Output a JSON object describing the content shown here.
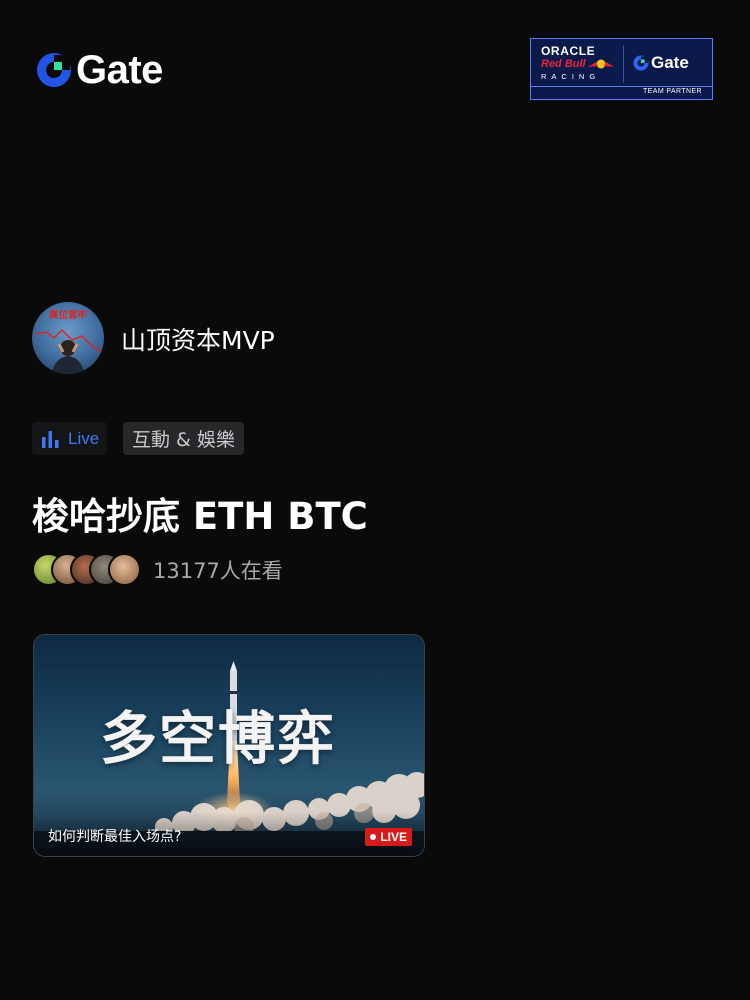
{
  "brand": {
    "name": "Gate",
    "accent": "#2354e6",
    "accent_green": "#2fe0a0"
  },
  "partner": {
    "oracle": "ORACLE",
    "redbull": "Red Bull",
    "racing": "RACING",
    "gate": "Gate",
    "team_partner": "TEAM PARTNER"
  },
  "host": {
    "name": "山顶资本MVP",
    "avatar_caption": "高位套牢"
  },
  "tags": {
    "live_label": "Live",
    "live_color": "#3f78f2",
    "category": "互動 & 娛樂"
  },
  "stream": {
    "title": "梭哈抄底 ETH BTC",
    "viewer_count": "13177人在看",
    "viewer_avatars": [
      "viewer-1",
      "viewer-2",
      "viewer-3",
      "viewer-4",
      "viewer-5"
    ]
  },
  "card": {
    "headline": "多空博弈",
    "caption": "如何判断最佳入场点?",
    "badge": "LIVE",
    "badge_color": "#d71a1a"
  }
}
